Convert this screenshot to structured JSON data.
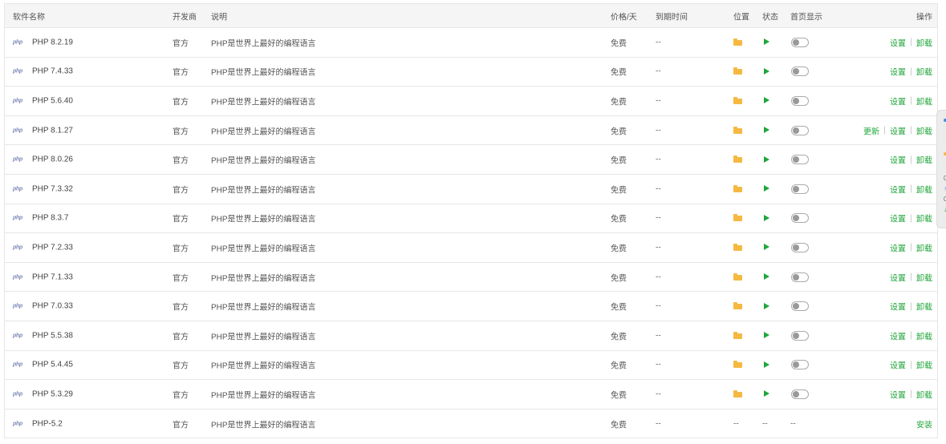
{
  "headers": {
    "name": "软件名称",
    "developer": "开发商",
    "description": "说明",
    "price": "价格/天",
    "expire": "到期时间",
    "location": "位置",
    "status": "状态",
    "home": "首页显示",
    "ops": "操作"
  },
  "rows": [
    {
      "name": "PHP 8.2.19",
      "dev": "官方",
      "desc": "PHP是世界上最好的编程语言",
      "price": "免费",
      "expire": "--",
      "installed": true,
      "ops": [
        "设置",
        "卸载"
      ]
    },
    {
      "name": "PHP 7.4.33",
      "dev": "官方",
      "desc": "PHP是世界上最好的编程语言",
      "price": "免费",
      "expire": "--",
      "installed": true,
      "ops": [
        "设置",
        "卸载"
      ]
    },
    {
      "name": "PHP 5.6.40",
      "dev": "官方",
      "desc": "PHP是世界上最好的编程语言",
      "price": "免费",
      "expire": "--",
      "installed": true,
      "ops": [
        "设置",
        "卸载"
      ]
    },
    {
      "name": "PHP 8.1.27",
      "dev": "官方",
      "desc": "PHP是世界上最好的编程语言",
      "price": "免费",
      "expire": "--",
      "installed": true,
      "ops": [
        "更新",
        "设置",
        "卸载"
      ]
    },
    {
      "name": "PHP 8.0.26",
      "dev": "官方",
      "desc": "PHP是世界上最好的编程语言",
      "price": "免费",
      "expire": "--",
      "installed": true,
      "ops": [
        "设置",
        "卸载"
      ]
    },
    {
      "name": "PHP 7.3.32",
      "dev": "官方",
      "desc": "PHP是世界上最好的编程语言",
      "price": "免费",
      "expire": "--",
      "installed": true,
      "ops": [
        "设置",
        "卸载"
      ]
    },
    {
      "name": "PHP 8.3.7",
      "dev": "官方",
      "desc": "PHP是世界上最好的编程语言",
      "price": "免费",
      "expire": "--",
      "installed": true,
      "ops": [
        "设置",
        "卸载"
      ]
    },
    {
      "name": "PHP 7.2.33",
      "dev": "官方",
      "desc": "PHP是世界上最好的编程语言",
      "price": "免费",
      "expire": "--",
      "installed": true,
      "ops": [
        "设置",
        "卸载"
      ]
    },
    {
      "name": "PHP 7.1.33",
      "dev": "官方",
      "desc": "PHP是世界上最好的编程语言",
      "price": "免费",
      "expire": "--",
      "installed": true,
      "ops": [
        "设置",
        "卸载"
      ]
    },
    {
      "name": "PHP 7.0.33",
      "dev": "官方",
      "desc": "PHP是世界上最好的编程语言",
      "price": "免费",
      "expire": "--",
      "installed": true,
      "ops": [
        "设置",
        "卸载"
      ]
    },
    {
      "name": "PHP 5.5.38",
      "dev": "官方",
      "desc": "PHP是世界上最好的编程语言",
      "price": "免费",
      "expire": "--",
      "installed": true,
      "ops": [
        "设置",
        "卸载"
      ]
    },
    {
      "name": "PHP 5.4.45",
      "dev": "官方",
      "desc": "PHP是世界上最好的编程语言",
      "price": "免费",
      "expire": "--",
      "installed": true,
      "ops": [
        "设置",
        "卸载"
      ]
    },
    {
      "name": "PHP 5.3.29",
      "dev": "官方",
      "desc": "PHP是世界上最好的编程语言",
      "price": "免费",
      "expire": "--",
      "installed": true,
      "ops": [
        "设置",
        "卸载"
      ]
    },
    {
      "name": "PHP-5.2",
      "dev": "官方",
      "desc": "PHP是世界上最好的编程语言",
      "price": "免费",
      "expire": "--",
      "installed": false,
      "location": "--",
      "status": "--",
      "home": "--",
      "ops": [
        "安装"
      ]
    }
  ],
  "logo_text": "php",
  "colors": {
    "link": "#20a53a",
    "folder": "#f5b942",
    "play": "#20a53a",
    "border": "#e6e6e6",
    "header_bg": "#f5f5f5"
  },
  "icons": {
    "location": "folder-icon",
    "status": "play-icon",
    "home": "toggle-switch"
  }
}
